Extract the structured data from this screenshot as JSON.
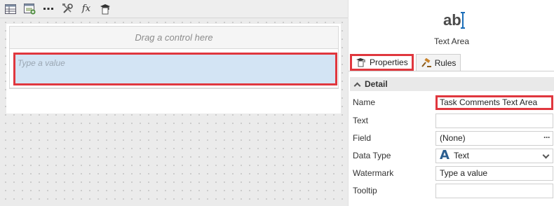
{
  "toolbar": {
    "buttons": [
      {
        "icon": "table-icon"
      },
      {
        "icon": "form-add-icon"
      },
      {
        "icon": "more-icon"
      },
      {
        "icon": "tools-icon"
      },
      {
        "icon": "function-icon",
        "label": "fx"
      },
      {
        "icon": "rule-hat-icon"
      }
    ]
  },
  "designer": {
    "drop_hint": "Drag a control here",
    "textarea_placeholder": "Type a value"
  },
  "panel": {
    "control_glyph": "ab",
    "control_type": "Text Area",
    "tabs": [
      {
        "label": "Properties",
        "active": true
      },
      {
        "label": "Rules",
        "active": false
      }
    ],
    "section": "Detail",
    "properties": {
      "name": {
        "label": "Name",
        "value": "Task Comments Text Area"
      },
      "text": {
        "label": "Text",
        "value": ""
      },
      "field": {
        "label": "Field",
        "value": "(None)",
        "button": "···"
      },
      "data_type": {
        "label": "Data Type",
        "icon_glyph": "A",
        "value": "Text"
      },
      "watermark": {
        "label": "Watermark",
        "value": "Type a value"
      },
      "tooltip": {
        "label": "Tooltip",
        "value": ""
      }
    }
  },
  "colors": {
    "highlight": "#e0373e",
    "selected_control": "#d3e4f4",
    "accent_blue": "#1b6db8"
  }
}
